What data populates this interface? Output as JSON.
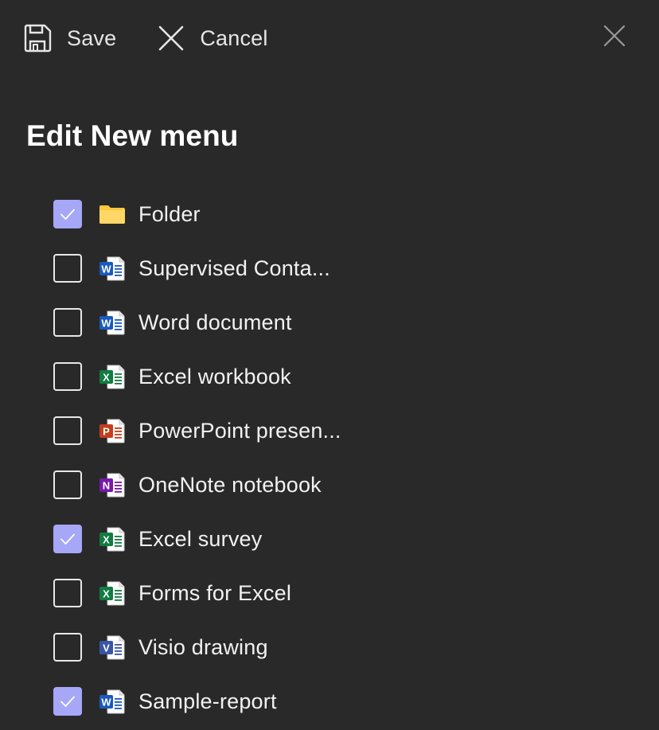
{
  "toolbar": {
    "save_label": "Save",
    "cancel_label": "Cancel"
  },
  "page": {
    "title": "Edit New menu"
  },
  "items": [
    {
      "label": "Folder",
      "checked": true,
      "icon": "folder-icon"
    },
    {
      "label": "Supervised Conta...",
      "checked": false,
      "icon": "word-icon"
    },
    {
      "label": "Word document",
      "checked": false,
      "icon": "word-icon"
    },
    {
      "label": "Excel workbook",
      "checked": false,
      "icon": "excel-icon"
    },
    {
      "label": "PowerPoint presen...",
      "checked": false,
      "icon": "powerpoint-icon"
    },
    {
      "label": "OneNote notebook",
      "checked": false,
      "icon": "onenote-icon"
    },
    {
      "label": "Excel survey",
      "checked": true,
      "icon": "excel-icon"
    },
    {
      "label": "Forms for Excel",
      "checked": false,
      "icon": "excel-icon"
    },
    {
      "label": "Visio drawing",
      "checked": false,
      "icon": "visio-icon"
    },
    {
      "label": "Sample-report",
      "checked": true,
      "icon": "word-icon"
    }
  ],
  "colors": {
    "background": "#292929",
    "checked": "#a7a7f8",
    "word": "#185abd",
    "excel": "#107c41",
    "powerpoint": "#c43e1c",
    "onenote": "#7719aa",
    "visio": "#3955a3",
    "folder": "#ffc83d"
  }
}
